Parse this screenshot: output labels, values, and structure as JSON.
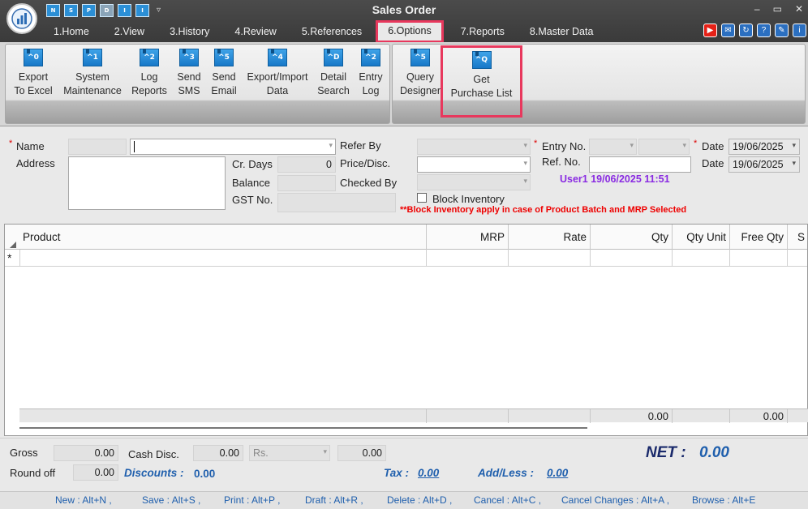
{
  "window": {
    "title": "Sales Order"
  },
  "quick_access": [
    "N",
    "S",
    "P",
    "D",
    "I",
    "I"
  ],
  "menu": [
    "1.Home",
    "2.View",
    "3.History",
    "4.Review",
    "5.References",
    "6.Options",
    "7.Reports",
    "8.Master Data"
  ],
  "ribbon": {
    "group1": [
      {
        "key": "^0",
        "label1": "Export",
        "label2": "To Excel"
      },
      {
        "key": "^1",
        "label1": "System",
        "label2": "Maintenance"
      },
      {
        "key": "^2",
        "label1": "Log",
        "label2": "Reports"
      },
      {
        "key": "^3",
        "label1": "Send",
        "label2": "SMS"
      },
      {
        "key": "^5",
        "label1": "Send",
        "label2": "Email"
      },
      {
        "key": "^4",
        "label1": "Export/Import",
        "label2": "Data"
      },
      {
        "key": "^D",
        "label1": "Detail",
        "label2": "Search"
      },
      {
        "key": "^2",
        "label1": "Entry",
        "label2": "Log"
      }
    ],
    "group2": [
      {
        "key": "^5",
        "label1": "Query",
        "label2": "Designer"
      },
      {
        "key": "^Q",
        "label1": "Get",
        "label2": "Purchase List"
      }
    ]
  },
  "form": {
    "name_label": "Name",
    "address_label": "Address",
    "cr_days_label": "Cr. Days",
    "cr_days_value": "0",
    "balance_label": "Balance",
    "gst_label": "GST No.",
    "refer_by_label": "Refer By",
    "price_disc_label": "Price/Disc.",
    "checked_by_label": "Checked By",
    "block_inventory_label": "Block Inventory",
    "block_warning": "**Block Inventory apply in case of Product Batch and MRP Selected",
    "entry_no_label": "Entry No.",
    "ref_no_label": "Ref. No.",
    "date_label": "Date",
    "date_value": "19/06/2025",
    "date2_label": "Date",
    "date2_value": "19/06/2025",
    "user_stamp": "User1 19/06/2025 11:51"
  },
  "grid": {
    "columns": [
      "Product",
      "MRP",
      "Rate",
      "Qty",
      "Qty Unit",
      "Free Qty",
      "S"
    ],
    "new_row_marker": "*",
    "footer_qty": "0.00",
    "footer_free_qty": "0.00"
  },
  "totals": {
    "gross_label": "Gross",
    "gross_value": "0.00",
    "cash_disc_label": "Cash Disc.",
    "cash_disc_value": "0.00",
    "cash_disc_type": "Rs.",
    "cash_disc_amount": "0.00",
    "round_off_label": "Round off",
    "round_off_value": "0.00",
    "discounts_label": "Discounts :",
    "discounts_value": "0.00",
    "tax_label": "Tax :",
    "tax_value": "0.00",
    "add_less_label": "Add/Less :",
    "add_less_value": "0.00",
    "net_label": "NET :",
    "net_value": "0.00"
  },
  "shortcuts": [
    "New : Alt+N ,",
    "Save : Alt+S ,",
    "Print : Alt+P ,",
    "Draft : Alt+R ,",
    "Delete : Alt+D ,",
    "Cancel : Alt+C ,",
    "Cancel Changes : Alt+A ,",
    "Browse : Alt+E"
  ],
  "colors": {
    "highlight": "#e8385d",
    "accent_blue": "#1f5fad",
    "user_stamp": "#8a2be2",
    "warning": "#e00000"
  }
}
